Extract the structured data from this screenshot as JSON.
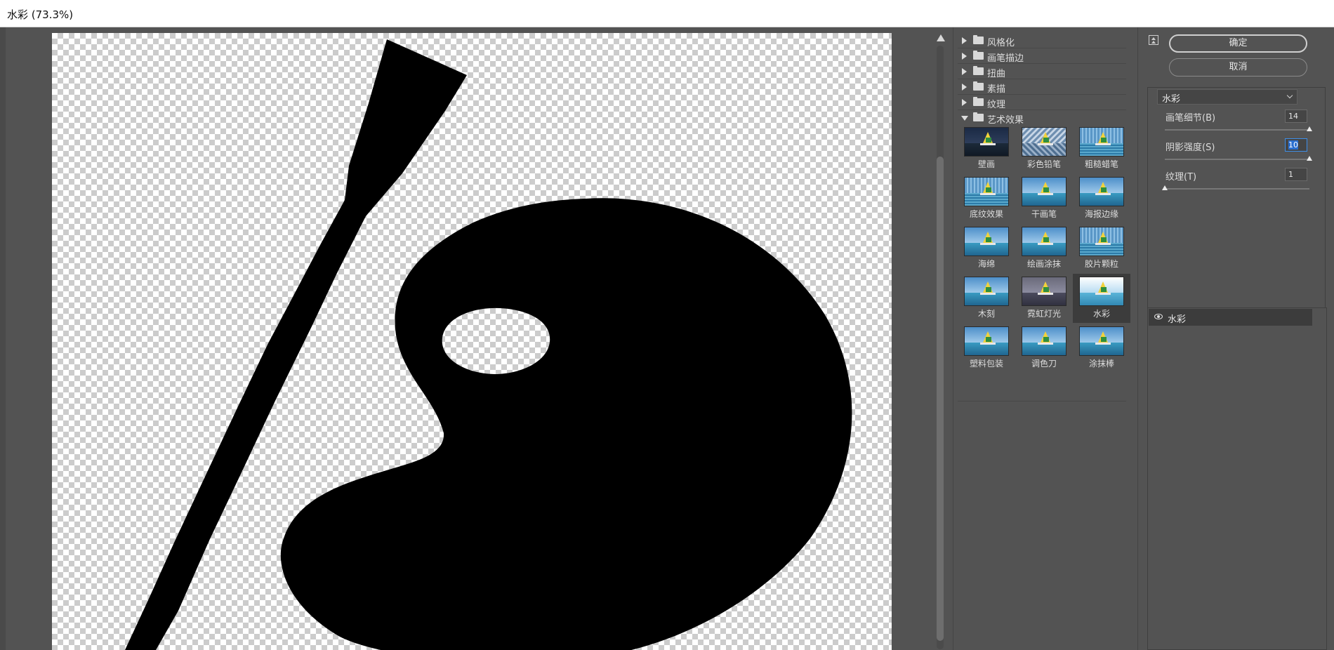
{
  "window": {
    "title": "水彩 (73.3%)"
  },
  "gallery": {
    "folders": [
      {
        "label": "风格化",
        "expanded": false
      },
      {
        "label": "画笔描边",
        "expanded": false
      },
      {
        "label": "扭曲",
        "expanded": false
      },
      {
        "label": "素描",
        "expanded": false
      },
      {
        "label": "纹理",
        "expanded": false
      },
      {
        "label": "艺术效果",
        "expanded": true
      }
    ],
    "filters": [
      {
        "label": "壁画",
        "style": "dark",
        "selected": false
      },
      {
        "label": "彩色铅笔",
        "style": "sketch",
        "selected": false
      },
      {
        "label": "粗糙蜡笔",
        "style": "mosaic",
        "selected": false
      },
      {
        "label": "底纹效果",
        "style": "mosaic",
        "selected": false
      },
      {
        "label": "干画笔",
        "style": "normal",
        "selected": false
      },
      {
        "label": "海报边缘",
        "style": "normal",
        "selected": false
      },
      {
        "label": "海绵",
        "style": "normal",
        "selected": false
      },
      {
        "label": "绘画涂抹",
        "style": "normal",
        "selected": false
      },
      {
        "label": "胶片颗粒",
        "style": "mosaic",
        "selected": false
      },
      {
        "label": "木刻",
        "style": "normal",
        "selected": false
      },
      {
        "label": "霓虹灯光",
        "style": "grey",
        "selected": false
      },
      {
        "label": "水彩",
        "style": "white",
        "selected": true
      },
      {
        "label": "塑料包装",
        "style": "normal",
        "selected": false
      },
      {
        "label": "调色刀",
        "style": "normal",
        "selected": false
      },
      {
        "label": "涂抹棒",
        "style": "normal",
        "selected": false
      }
    ]
  },
  "settings": {
    "ok_label": "确定",
    "cancel_label": "取消",
    "filter_select": "水彩",
    "params": [
      {
        "label": "画笔细节(B)",
        "value": "14",
        "fraction": 1.0
      },
      {
        "label": "阴影强度(S)",
        "value": "10",
        "fraction": 1.0
      },
      {
        "label": "纹理(T)",
        "value": "1",
        "fraction": 0.0
      }
    ],
    "effect_layer": "水彩"
  },
  "colors": {
    "ui_background": "#535353",
    "selection": "#3c3c3c",
    "focus": "#3d8ee8",
    "checker": "#cccccc"
  }
}
